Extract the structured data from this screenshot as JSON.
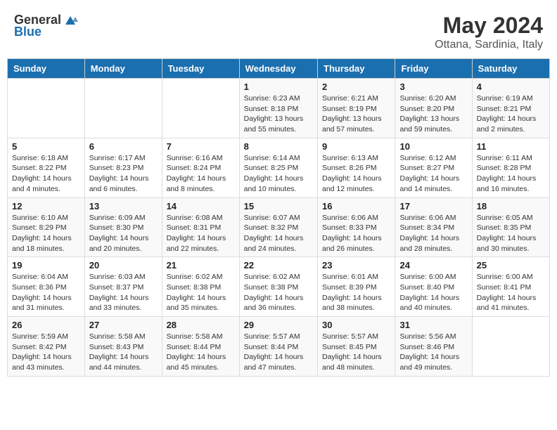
{
  "header": {
    "logo_general": "General",
    "logo_blue": "Blue",
    "month": "May 2024",
    "location": "Ottana, Sardinia, Italy"
  },
  "weekdays": [
    "Sunday",
    "Monday",
    "Tuesday",
    "Wednesday",
    "Thursday",
    "Friday",
    "Saturday"
  ],
  "weeks": [
    [
      {
        "day": "",
        "info": ""
      },
      {
        "day": "",
        "info": ""
      },
      {
        "day": "",
        "info": ""
      },
      {
        "day": "1",
        "info": "Sunrise: 6:23 AM\nSunset: 8:18 PM\nDaylight: 13 hours\nand 55 minutes."
      },
      {
        "day": "2",
        "info": "Sunrise: 6:21 AM\nSunset: 8:19 PM\nDaylight: 13 hours\nand 57 minutes."
      },
      {
        "day": "3",
        "info": "Sunrise: 6:20 AM\nSunset: 8:20 PM\nDaylight: 13 hours\nand 59 minutes."
      },
      {
        "day": "4",
        "info": "Sunrise: 6:19 AM\nSunset: 8:21 PM\nDaylight: 14 hours\nand 2 minutes."
      }
    ],
    [
      {
        "day": "5",
        "info": "Sunrise: 6:18 AM\nSunset: 8:22 PM\nDaylight: 14 hours\nand 4 minutes."
      },
      {
        "day": "6",
        "info": "Sunrise: 6:17 AM\nSunset: 8:23 PM\nDaylight: 14 hours\nand 6 minutes."
      },
      {
        "day": "7",
        "info": "Sunrise: 6:16 AM\nSunset: 8:24 PM\nDaylight: 14 hours\nand 8 minutes."
      },
      {
        "day": "8",
        "info": "Sunrise: 6:14 AM\nSunset: 8:25 PM\nDaylight: 14 hours\nand 10 minutes."
      },
      {
        "day": "9",
        "info": "Sunrise: 6:13 AM\nSunset: 8:26 PM\nDaylight: 14 hours\nand 12 minutes."
      },
      {
        "day": "10",
        "info": "Sunrise: 6:12 AM\nSunset: 8:27 PM\nDaylight: 14 hours\nand 14 minutes."
      },
      {
        "day": "11",
        "info": "Sunrise: 6:11 AM\nSunset: 8:28 PM\nDaylight: 14 hours\nand 16 minutes."
      }
    ],
    [
      {
        "day": "12",
        "info": "Sunrise: 6:10 AM\nSunset: 8:29 PM\nDaylight: 14 hours\nand 18 minutes."
      },
      {
        "day": "13",
        "info": "Sunrise: 6:09 AM\nSunset: 8:30 PM\nDaylight: 14 hours\nand 20 minutes."
      },
      {
        "day": "14",
        "info": "Sunrise: 6:08 AM\nSunset: 8:31 PM\nDaylight: 14 hours\nand 22 minutes."
      },
      {
        "day": "15",
        "info": "Sunrise: 6:07 AM\nSunset: 8:32 PM\nDaylight: 14 hours\nand 24 minutes."
      },
      {
        "day": "16",
        "info": "Sunrise: 6:06 AM\nSunset: 8:33 PM\nDaylight: 14 hours\nand 26 minutes."
      },
      {
        "day": "17",
        "info": "Sunrise: 6:06 AM\nSunset: 8:34 PM\nDaylight: 14 hours\nand 28 minutes."
      },
      {
        "day": "18",
        "info": "Sunrise: 6:05 AM\nSunset: 8:35 PM\nDaylight: 14 hours\nand 30 minutes."
      }
    ],
    [
      {
        "day": "19",
        "info": "Sunrise: 6:04 AM\nSunset: 8:36 PM\nDaylight: 14 hours\nand 31 minutes."
      },
      {
        "day": "20",
        "info": "Sunrise: 6:03 AM\nSunset: 8:37 PM\nDaylight: 14 hours\nand 33 minutes."
      },
      {
        "day": "21",
        "info": "Sunrise: 6:02 AM\nSunset: 8:38 PM\nDaylight: 14 hours\nand 35 minutes."
      },
      {
        "day": "22",
        "info": "Sunrise: 6:02 AM\nSunset: 8:38 PM\nDaylight: 14 hours\nand 36 minutes."
      },
      {
        "day": "23",
        "info": "Sunrise: 6:01 AM\nSunset: 8:39 PM\nDaylight: 14 hours\nand 38 minutes."
      },
      {
        "day": "24",
        "info": "Sunrise: 6:00 AM\nSunset: 8:40 PM\nDaylight: 14 hours\nand 40 minutes."
      },
      {
        "day": "25",
        "info": "Sunrise: 6:00 AM\nSunset: 8:41 PM\nDaylight: 14 hours\nand 41 minutes."
      }
    ],
    [
      {
        "day": "26",
        "info": "Sunrise: 5:59 AM\nSunset: 8:42 PM\nDaylight: 14 hours\nand 43 minutes."
      },
      {
        "day": "27",
        "info": "Sunrise: 5:58 AM\nSunset: 8:43 PM\nDaylight: 14 hours\nand 44 minutes."
      },
      {
        "day": "28",
        "info": "Sunrise: 5:58 AM\nSunset: 8:44 PM\nDaylight: 14 hours\nand 45 minutes."
      },
      {
        "day": "29",
        "info": "Sunrise: 5:57 AM\nSunset: 8:44 PM\nDaylight: 14 hours\nand 47 minutes."
      },
      {
        "day": "30",
        "info": "Sunrise: 5:57 AM\nSunset: 8:45 PM\nDaylight: 14 hours\nand 48 minutes."
      },
      {
        "day": "31",
        "info": "Sunrise: 5:56 AM\nSunset: 8:46 PM\nDaylight: 14 hours\nand 49 minutes."
      },
      {
        "day": "",
        "info": ""
      }
    ]
  ]
}
